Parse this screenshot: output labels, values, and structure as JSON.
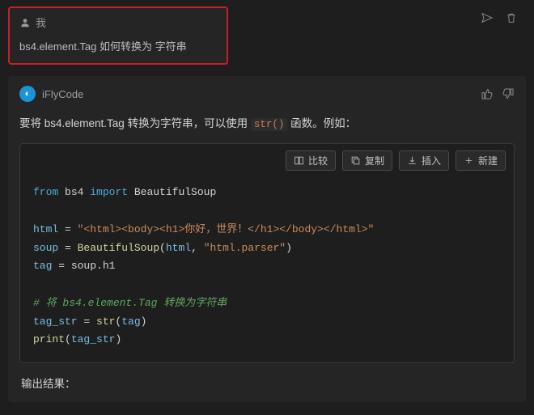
{
  "user": {
    "name": "我",
    "message": "bs4.element.Tag 如何转换为 字符串"
  },
  "assistant": {
    "name": "iFlyCode",
    "avatar_char": "◐",
    "intro_before": "要将 bs4.element.Tag 转换为字符串，可以使用 ",
    "intro_code": "str()",
    "intro_after": " 函数。例如：",
    "code": {
      "l1_kw_from": "from",
      "l1_mod": " bs4 ",
      "l1_kw_import": "import",
      "l1_name": " BeautifulSoup",
      "l3_var": "html",
      "l3_eq": " = ",
      "l3_str": "\"<html><body><h1>你好，世界！</h1></body></html>\"",
      "l4_var": "soup",
      "l4_eq": " = ",
      "l4_fn": "BeautifulSoup",
      "l4_args_open": "(",
      "l4_arg1": "html",
      "l4_sep": ", ",
      "l4_arg2": "\"html.parser\"",
      "l4_args_close": ")",
      "l5_var": "tag",
      "l5_eq": " = ",
      "l5_rhs": "soup.h1",
      "l7_cmt": "# 将 bs4.element.Tag 转换为字符串",
      "l8_var": "tag_str",
      "l8_eq": " = ",
      "l8_fn": "str",
      "l8_args_open": "(",
      "l8_arg": "tag",
      "l8_args_close": ")",
      "l9_fn": "print",
      "l9_args_open": "(",
      "l9_arg": "tag_str",
      "l9_args_close": ")"
    },
    "output_label": "输出结果："
  },
  "toolbar": {
    "compare": "比较",
    "copy": "复制",
    "insert": "插入",
    "new": "新建"
  }
}
